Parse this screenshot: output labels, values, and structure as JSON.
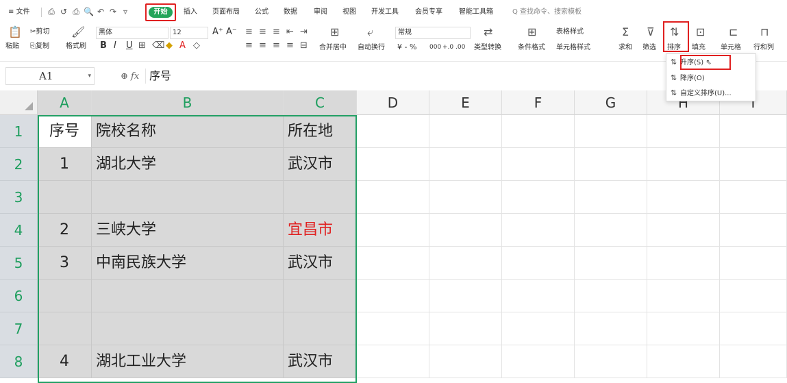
{
  "menubar": {
    "file": "≡ 文件",
    "quick_icons": [
      "⎙",
      "↺",
      "⎙",
      "🔍",
      "↶",
      "↷",
      "▿"
    ],
    "tabs": [
      "开始",
      "插入",
      "页面布局",
      "公式",
      "数据",
      "审阅",
      "视图",
      "开发工具",
      "会员专享",
      "智能工具箱"
    ],
    "search": "Q 查找命令、搜索模板"
  },
  "ribbon": {
    "paste": "粘贴",
    "cut": "剪切",
    "copy": "复制",
    "format_painter": "格式刷",
    "font_name": "黑体",
    "font_size": "12",
    "merge_center": "合并居中",
    "wrap": "自动换行",
    "number_format": "常规",
    "type_convert": "类型转换",
    "cond_format": "条件格式",
    "table_style": "表格样式",
    "cell_style": "单元格样式",
    "sum": "求和",
    "filter": "筛选",
    "sort": "排序",
    "fill": "填充",
    "cell": "单元格",
    "rowcol": "行和列",
    "bold": "B",
    "italic": "I",
    "underline": "U",
    "grow": "A⁺",
    "shrink": "A⁻",
    "percent": "¥ - %",
    "thousands": "000",
    "inc_dec": "+.0  .00"
  },
  "dropdown": {
    "ascending": "升序(S)",
    "descending": "降序(O)",
    "custom": "自定义排序(U)..."
  },
  "formula_bar": {
    "name_box": "A1",
    "content": "序号"
  },
  "columns": [
    "A",
    "B",
    "C",
    "D",
    "E",
    "F",
    "G",
    "H",
    "I"
  ],
  "rows": [
    "1",
    "2",
    "3",
    "4",
    "5",
    "6",
    "7",
    "8"
  ],
  "table": [
    [
      "序号",
      "院校名称",
      "所在地"
    ],
    [
      "1",
      "湖北大学",
      "武汉市"
    ],
    [
      "",
      "",
      ""
    ],
    [
      "2",
      "三峡大学",
      "宜昌市"
    ],
    [
      "3",
      "中南民族大学",
      "武汉市"
    ],
    [
      "",
      "",
      ""
    ],
    [
      "",
      "",
      ""
    ],
    [
      "4",
      "湖北工业大学",
      "武汉市"
    ]
  ],
  "colors": {
    "accent_green": "#22a065",
    "highlight_red": "#e02020",
    "red_text": "#e02020"
  }
}
